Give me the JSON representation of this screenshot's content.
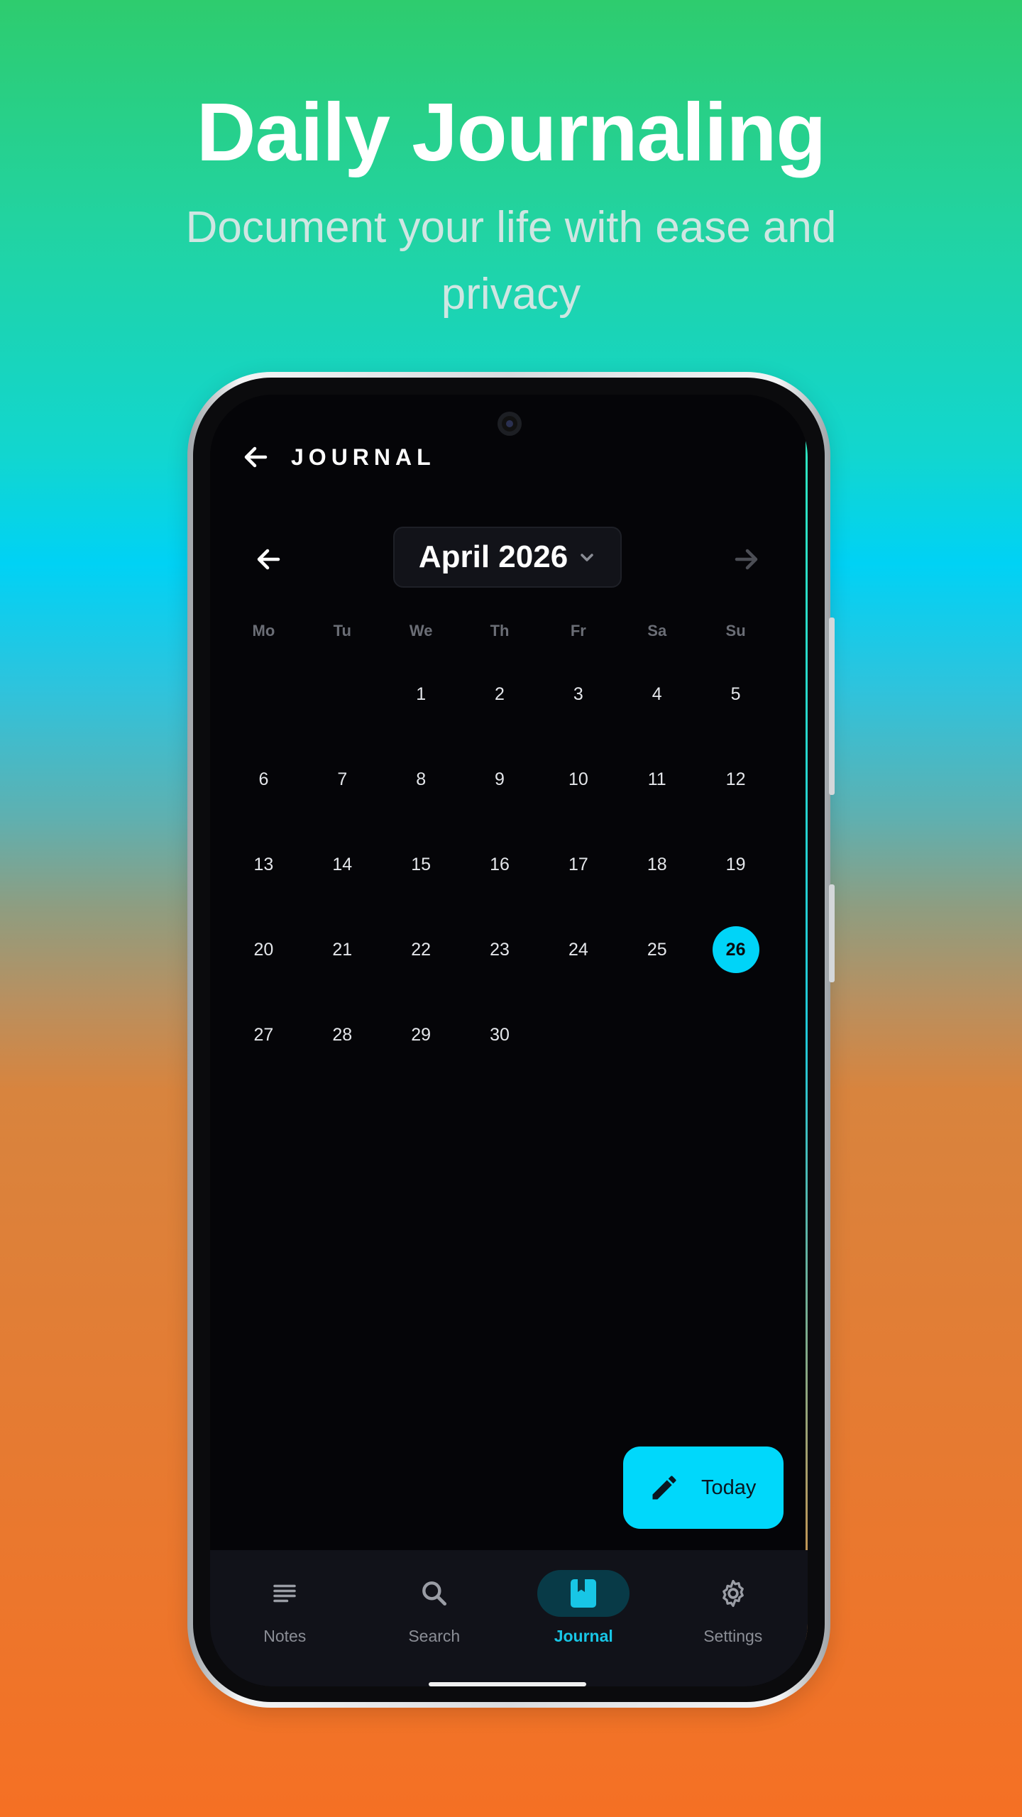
{
  "hero": {
    "title": "Daily Journaling",
    "subtitle": "Document your life with ease and privacy"
  },
  "app_bar": {
    "title": "JOURNAL",
    "back_icon": "arrow-left-icon"
  },
  "calendar": {
    "month_label": "April 2026",
    "weekdays": [
      "Mo",
      "Tu",
      "We",
      "Th",
      "Fr",
      "Sa",
      "Su"
    ],
    "weeks": [
      [
        "",
        "",
        "1",
        "2",
        "3",
        "4",
        "5"
      ],
      [
        "6",
        "7",
        "8",
        "9",
        "10",
        "11",
        "12"
      ],
      [
        "13",
        "14",
        "15",
        "16",
        "17",
        "18",
        "19"
      ],
      [
        "20",
        "21",
        "22",
        "23",
        "24",
        "25",
        "26"
      ],
      [
        "27",
        "28",
        "29",
        "30",
        "",
        "",
        ""
      ]
    ],
    "selected_day": "26"
  },
  "fab": {
    "label": "Today",
    "icon": "pencil-icon"
  },
  "bottom_nav": {
    "items": [
      {
        "label": "Notes",
        "icon": "notes-icon",
        "active": false
      },
      {
        "label": "Search",
        "icon": "search-icon",
        "active": false
      },
      {
        "label": "Journal",
        "icon": "journal-book-icon",
        "active": true
      },
      {
        "label": "Settings",
        "icon": "gear-icon",
        "active": false
      }
    ]
  },
  "colors": {
    "accent": "#00D4F8",
    "screen_background": "#050508",
    "nav_background": "#111219"
  }
}
